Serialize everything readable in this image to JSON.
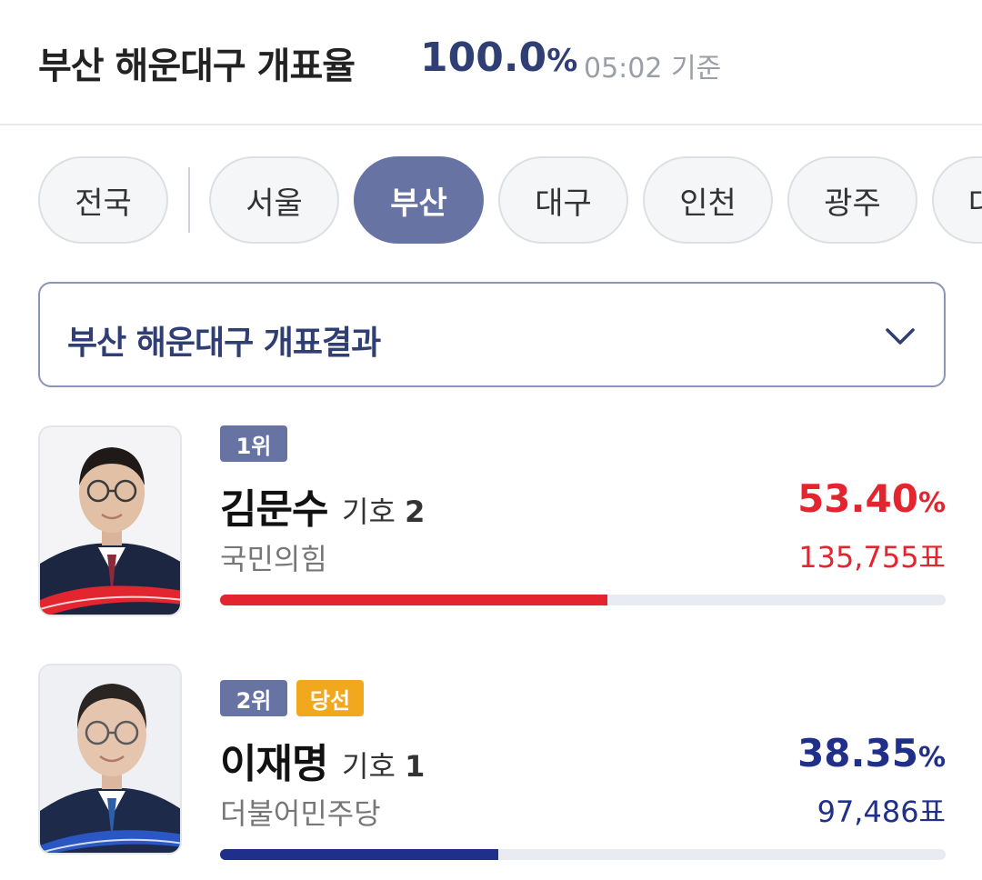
{
  "header": {
    "title": "부산 해운대구 개표율",
    "rate_value": "100.0",
    "rate_unit": "%",
    "time": "05:02 기준"
  },
  "tabs": [
    {
      "label": "전국",
      "active": false
    },
    {
      "label": "서울",
      "active": false
    },
    {
      "label": "부산",
      "active": true
    },
    {
      "label": "대구",
      "active": false
    },
    {
      "label": "인천",
      "active": false
    },
    {
      "label": "광주",
      "active": false
    },
    {
      "label": "대",
      "active": false
    }
  ],
  "dropdown": {
    "label": "부산 해운대구 개표결과",
    "icon": "chevron-down-icon"
  },
  "candidates": [
    {
      "rank": "1위",
      "winner_label": "",
      "name": "김문수",
      "number_prefix": "기호",
      "number": "2",
      "party": "국민의힘",
      "pct_value": "53.40",
      "pct_unit": "%",
      "votes": "135,755표",
      "share": 0.534,
      "color": "#e3252f"
    },
    {
      "rank": "2위",
      "winner_label": "당선",
      "name": "이재명",
      "number_prefix": "기호",
      "number": "1",
      "party": "더불어민주당",
      "pct_value": "38.35",
      "pct_unit": "%",
      "votes": "97,486표",
      "share": 0.3835,
      "color": "#1f2f8a"
    }
  ],
  "colors": {
    "accent": "#6774a3",
    "title_blue": "#2f3f73",
    "party1": "#e3252f",
    "party2": "#1f2f8a",
    "win_badge": "#f2a81d"
  }
}
